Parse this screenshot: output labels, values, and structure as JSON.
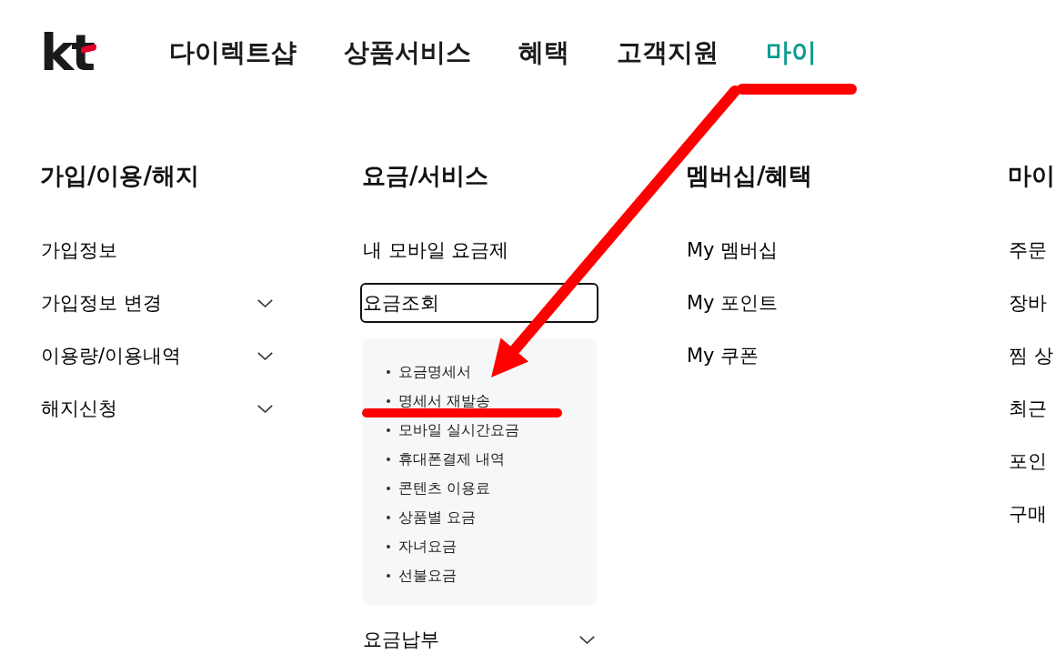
{
  "header": {
    "logo": "kt",
    "nav": [
      {
        "label": "다이렉트샵",
        "selected": false,
        "annotated": false
      },
      {
        "label": "상품서비스",
        "selected": false,
        "annotated": false
      },
      {
        "label": "혜택",
        "selected": false,
        "annotated": false
      },
      {
        "label": "고객지원",
        "selected": false,
        "annotated": false
      },
      {
        "label": "마이",
        "selected": true,
        "annotated": true
      }
    ]
  },
  "menu": {
    "columns": [
      {
        "heading": "가입/이용/해지",
        "items": [
          {
            "label": "가입정보",
            "kind": "link",
            "focused": false
          },
          {
            "label": "가입정보 변경",
            "kind": "toggle",
            "focused": false
          },
          {
            "label": "이용량/이용내역",
            "kind": "toggle",
            "focused": false
          },
          {
            "label": "해지신청",
            "kind": "toggle",
            "focused": false
          }
        ]
      },
      {
        "heading": "요금/서비스",
        "items": [
          {
            "label": "내 모바일 요금제",
            "kind": "link",
            "focused": false
          },
          {
            "label": "요금조회",
            "kind": "link",
            "focused": true,
            "children": [
              {
                "label": "요금명세서",
                "annotated": false
              },
              {
                "label": "명세서 재발송",
                "annotated": true
              },
              {
                "label": "모바일 실시간요금",
                "annotated": false
              },
              {
                "label": "휴대폰결제 내역",
                "annotated": false
              },
              {
                "label": "콘텐츠 이용료",
                "annotated": false
              },
              {
                "label": "상품별 요금",
                "annotated": false
              },
              {
                "label": "자녀요금",
                "annotated": false
              },
              {
                "label": "선불요금",
                "annotated": false
              }
            ]
          },
          {
            "label": "요금납부",
            "kind": "toggle",
            "focused": false
          }
        ]
      },
      {
        "heading": "멤버십/혜택",
        "items": [
          {
            "label": "My 멤버십",
            "kind": "link",
            "focused": false
          },
          {
            "label": "My 포인트",
            "kind": "link",
            "focused": false
          },
          {
            "label": "My 쿠폰",
            "kind": "link",
            "focused": false
          }
        ]
      },
      {
        "heading": "마이",
        "items": [
          {
            "label": "주문",
            "kind": "link",
            "focused": false
          },
          {
            "label": "장바",
            "kind": "link",
            "focused": false
          },
          {
            "label": "찜 상",
            "kind": "link",
            "focused": false
          },
          {
            "label": "최근",
            "kind": "link",
            "focused": false
          },
          {
            "label": "포인",
            "kind": "link",
            "focused": false
          },
          {
            "label": "구매",
            "kind": "link",
            "focused": false
          }
        ]
      }
    ]
  }
}
